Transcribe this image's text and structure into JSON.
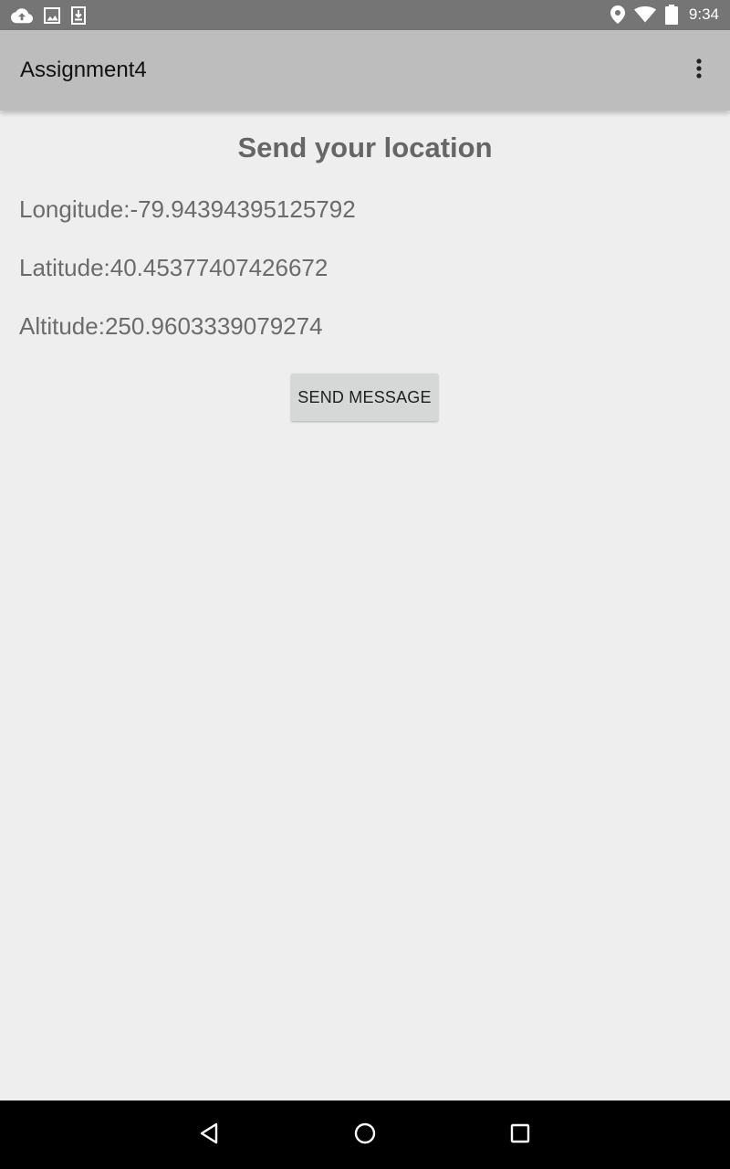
{
  "status_bar": {
    "time": "9:34",
    "left_icons": [
      "cloud-upload-icon",
      "image-icon",
      "download-icon"
    ],
    "right_icons": [
      "location-pin-icon",
      "wifi-icon",
      "battery-icon"
    ]
  },
  "app_bar": {
    "title": "Assignment4",
    "overflow_icon": "more-vert-icon"
  },
  "main": {
    "heading": "Send your location",
    "longitude": "Longitude:-79.94394395125792",
    "latitude": "Latitude:40.45377407426672",
    "altitude": "Altitude:250.9603339079274",
    "send_button_label": "SEND MESSAGE"
  },
  "nav_bar": {
    "icons": [
      "back-icon",
      "home-icon",
      "recents-icon"
    ]
  },
  "colors": {
    "status_bar": "#757575",
    "app_bar": "#bdbdbd",
    "background": "#eeeeee",
    "button": "#d6d7d7",
    "nav_bar": "#000000"
  }
}
